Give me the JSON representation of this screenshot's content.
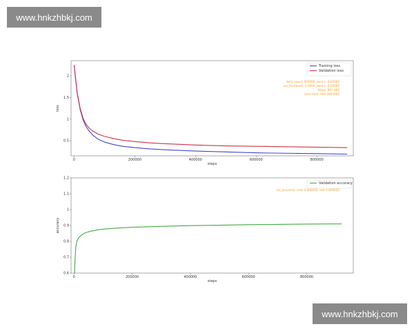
{
  "watermarks": {
    "top": "www.hnkzhbkj.com",
    "bottom": "www.hnkzhbkj.com"
  },
  "chart_data": [
    {
      "type": "line",
      "xlabel": "steps",
      "ylabel": "loss",
      "xlim": [
        -10000,
        920000
      ],
      "ylim": [
        0.15,
        2.35
      ],
      "x_ticks": [
        0,
        200000,
        400000,
        600000,
        800000
      ],
      "y_ticks": [
        0.5,
        1.0,
        1.5,
        2.0
      ],
      "legend_position": "top-right",
      "series": [
        {
          "name": "Training loss",
          "color": "#4444cc",
          "x": [
            0,
            10000,
            20000,
            30000,
            40000,
            50000,
            60000,
            80000,
            100000,
            130000,
            160000,
            200000,
            250000,
            300000,
            400000,
            500000,
            600000,
            700000,
            800000,
            900000
          ],
          "values": [
            2.25,
            1.6,
            1.22,
            0.97,
            0.82,
            0.72,
            0.64,
            0.53,
            0.47,
            0.41,
            0.37,
            0.34,
            0.31,
            0.29,
            0.26,
            0.24,
            0.22,
            0.21,
            0.2,
            0.19
          ]
        },
        {
          "name": "Validation loss",
          "color": "#cc3344",
          "x": [
            0,
            10000,
            20000,
            30000,
            40000,
            50000,
            60000,
            80000,
            100000,
            130000,
            160000,
            200000,
            250000,
            300000,
            400000,
            500000,
            600000,
            700000,
            800000,
            900000
          ],
          "values": [
            2.25,
            1.62,
            1.25,
            1.01,
            0.87,
            0.79,
            0.73,
            0.65,
            0.6,
            0.55,
            0.51,
            0.48,
            0.45,
            0.43,
            0.4,
            0.38,
            0.37,
            0.36,
            0.35,
            0.34
          ]
        }
      ],
      "annotations": [
        "best round: 000000, best c: 0.00000",
        "val_loss(best): 0.0000, best c: 0.00000",
        "Steps: 897,000",
        "best time: 000.0000000"
      ]
    },
    {
      "type": "line",
      "xlabel": "steps",
      "ylabel": "accuracy",
      "xlim": [
        -10000,
        960000
      ],
      "ylim": [
        0.6,
        1.2
      ],
      "x_ticks": [
        0,
        200000,
        400000,
        600000,
        800000
      ],
      "y_ticks": [
        0.6,
        0.7,
        0.8,
        0.9,
        1.0,
        1.1,
        1.2
      ],
      "legend_position": "top-right",
      "series": [
        {
          "name": "Validation accuracy",
          "color": "#44aa44",
          "x": [
            2000,
            4000,
            6000,
            10000,
            15000,
            20000,
            30000,
            40000,
            60000,
            80000,
            100000,
            150000,
            200000,
            300000,
            400000,
            500000,
            600000,
            700000,
            800000,
            900000,
            920000
          ],
          "values": [
            0.6,
            0.7,
            0.76,
            0.8,
            0.82,
            0.83,
            0.845,
            0.855,
            0.865,
            0.872,
            0.877,
            0.884,
            0.889,
            0.895,
            0.899,
            0.902,
            0.905,
            0.907,
            0.909,
            0.91,
            0.91
          ]
        }
      ],
      "annotations": [
        "val_accuracy: max 0.000000, last 0.000000"
      ]
    }
  ]
}
